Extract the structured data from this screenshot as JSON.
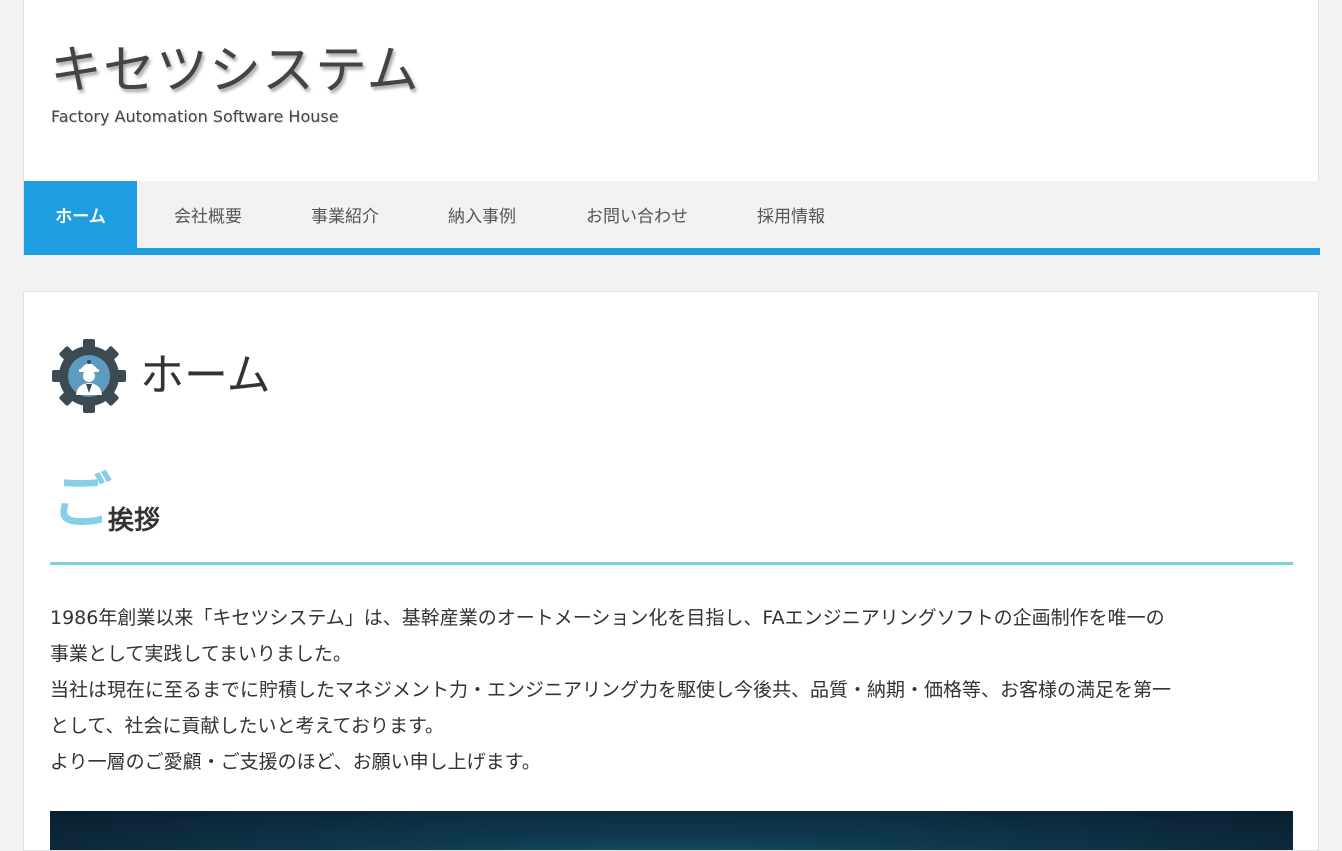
{
  "header": {
    "site_title": "キセツシステム",
    "tagline": "Factory Automation Software House"
  },
  "nav": {
    "items": [
      {
        "label": "ホーム",
        "active": true
      },
      {
        "label": "会社概要",
        "active": false
      },
      {
        "label": "事業紹介",
        "active": false
      },
      {
        "label": "納入事例",
        "active": false
      },
      {
        "label": "お問い合わせ",
        "active": false
      },
      {
        "label": "採用情報",
        "active": false
      }
    ],
    "accent_color": "#1e9de0"
  },
  "main": {
    "page_title": "ホーム",
    "page_icon": "gear-engineer-icon",
    "section": {
      "heading_first_char": "ご",
      "heading_rest": "挨拶",
      "accent_color": "#7fd0e0"
    },
    "paragraphs": [
      "1986年創業以来「キセツシステム」は、基幹産業のオートメーション化を目指し、FAエンジニアリングソフトの企画制作を唯一の",
      "事業として実践してまいりました。",
      "当社は現在に至るまでに貯積したマネジメント力・エンジニアリング力を駆使し今後共、品質・納期・価格等、お客様の満足を第一",
      "として、社会に貢献したいと考えております。",
      "より一層のご愛顧・ご支援のほど、お願い申し上げます。"
    ]
  }
}
